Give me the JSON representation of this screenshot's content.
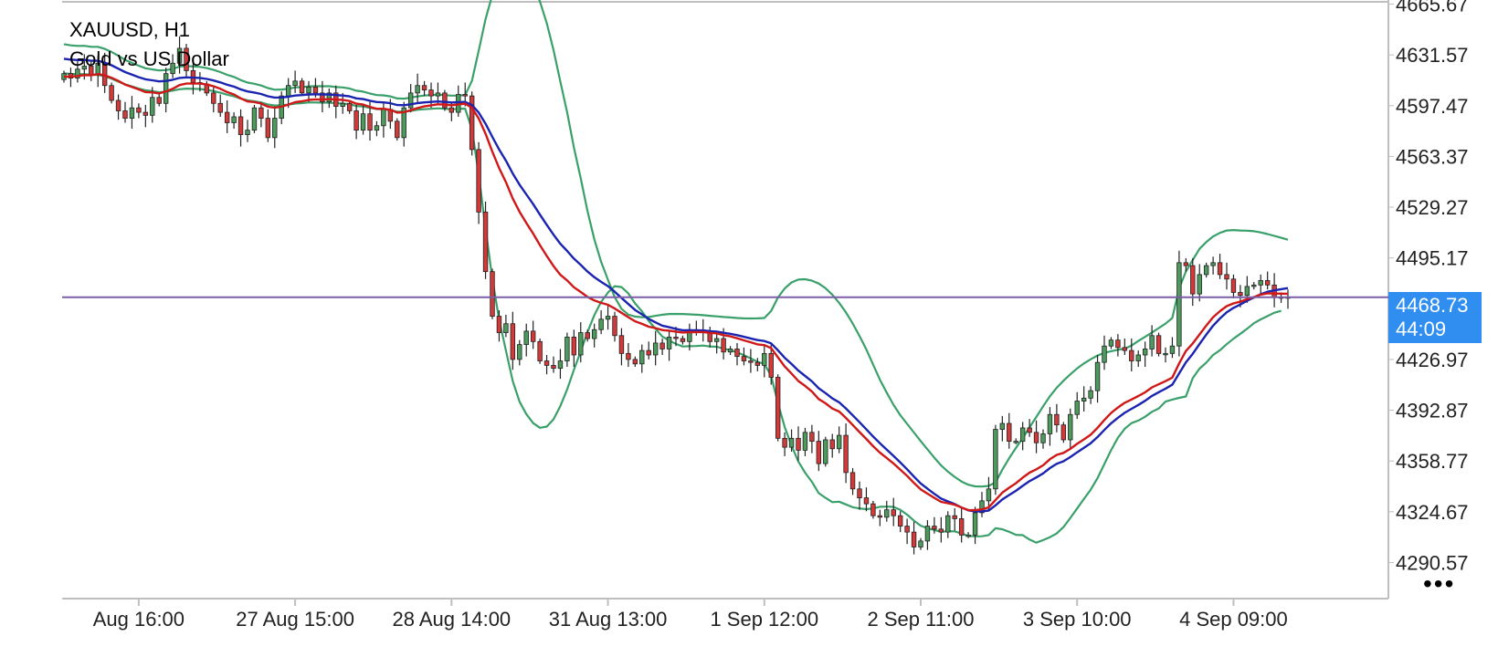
{
  "header": {
    "symbol": "XAUUSD, H1",
    "description": "Gold vs US Dollar"
  },
  "price_tag": {
    "price": "4468.73",
    "countdown": "44:09"
  },
  "menu": {
    "more_label": "•••"
  },
  "colors": {
    "bull_candle": "#4c9a5c",
    "bear_candle": "#d23a3a",
    "bollinger": "#3aa06a",
    "ma_fast": "#d01818",
    "ma_slow": "#1a24b0",
    "price_line": "#7a5ea8",
    "price_tag_bg": "#2f8ef0",
    "axis": "#bfbfbf"
  },
  "chart_data": {
    "type": "candlestick",
    "symbol": "XAUUSD",
    "timeframe": "H1",
    "current_price": 4468.73,
    "ylim": [
      4270,
      4666
    ],
    "y_ticks": [
      "4665.67",
      "4631.57",
      "4597.47",
      "4563.37",
      "4529.27",
      "4495.17",
      "4426.97",
      "4392.87",
      "4358.77",
      "4324.67",
      "4290.57"
    ],
    "y_tick_values": [
      4665.67,
      4631.57,
      4597.47,
      4563.37,
      4529.27,
      4495.17,
      4426.97,
      4392.87,
      4358.77,
      4324.67,
      4290.57
    ],
    "x_ticks": [
      {
        "label": "Aug 16:00",
        "bar": 11
      },
      {
        "label": "27 Aug 15:00",
        "bar": 34
      },
      {
        "label": "28 Aug 14:00",
        "bar": 57
      },
      {
        "label": "31 Aug 13:00",
        "bar": 80
      },
      {
        "label": "1 Sep 12:00",
        "bar": 103
      },
      {
        "label": "2 Sep 11:00",
        "bar": 126
      },
      {
        "label": "3 Sep 10:00",
        "bar": 149
      },
      {
        "label": "4 Sep 09:00",
        "bar": 172
      }
    ],
    "closes": [
      4619,
      4616,
      4622,
      4624,
      4618,
      4626,
      4611,
      4601,
      4594,
      4589,
      4596,
      4593,
      4591,
      4603,
      4599,
      4619,
      4626,
      4636,
      4621,
      4613,
      4612,
      4606,
      4599,
      4593,
      4586,
      4590,
      4578,
      4581,
      4596,
      4589,
      4576,
      4589,
      4604,
      4611,
      4614,
      4606,
      4610,
      4606,
      4600,
      4606,
      4597,
      4599,
      4594,
      4581,
      4592,
      4581,
      4584,
      4595,
      4587,
      4576,
      4596,
      4606,
      4611,
      4608,
      4604,
      4606,
      4596,
      4593,
      4605,
      4604,
      4568,
      4526,
      4486,
      4456,
      4445,
      4451,
      4427,
      4437,
      4446,
      4439,
      4426,
      4423,
      4421,
      4426,
      4442,
      4430,
      4445,
      4441,
      4447,
      4454,
      4456,
      4443,
      4431,
      4427,
      4424,
      4433,
      4430,
      4438,
      4434,
      4442,
      4441,
      4439,
      4447,
      4446,
      4446,
      4439,
      4441,
      4432,
      4434,
      4429,
      4426,
      4425,
      4423,
      4431,
      4415,
      4374,
      4368,
      4374,
      4366,
      4378,
      4372,
      4357,
      4373,
      4367,
      4376,
      4351,
      4340,
      4334,
      4330,
      4322,
      4321,
      4326,
      4322,
      4315,
      4311,
      4301,
      4305,
      4315,
      4313,
      4311,
      4322,
      4320,
      4309,
      4309,
      4324,
      4332,
      4340,
      4380,
      4384,
      4372,
      4372,
      4381,
      4378,
      4371,
      4377,
      4390,
      4383,
      4373,
      4390,
      4399,
      4401,
      4406,
      4425,
      4436,
      4440,
      4435,
      4433,
      4426,
      4430,
      4434,
      4443,
      4431,
      4431,
      4436,
      4492,
      4490,
      4471,
      4484,
      4490,
      4492,
      4484,
      4481,
      4472,
      4470,
      4476,
      4477,
      4480,
      4477,
      4469,
      4469,
      4469
    ],
    "series": [
      {
        "name": "Fast MA",
        "color": "#d01818",
        "values": [
          4617.0,
          4616.9,
          4617.4,
          4618.0,
          4617.9,
          4618.7,
          4617.9,
          4616.2,
          4614.1,
          4611.6,
          4610.1,
          4608.4,
          4606.6,
          4606.4,
          4605.7,
          4607.0,
          4608.8,
          4611.3,
          4612.3,
          4612.3,
          4612.3,
          4611.7,
          4610.5,
          4608.8,
          4606.6,
          4605.0,
          4602.4,
          4600.3,
          4599.9,
          4598.9,
          4596.8,
          4596.1,
          4596.8,
          4598.2,
          4599.8,
          4600.4,
          4601.3,
          4601.7,
          4601.5,
          4601.9,
          4601.5,
          4601.3,
          4600.6,
          4598.8,
          4598.2,
          4596.6,
          4595.4,
          4595.4,
          4594.7,
          4592.8,
          4593.1,
          4594.4,
          4595.9,
          4597.0,
          4597.7,
          4598.4,
          4598.2,
          4597.7,
          4598.3,
          4598.8,
          4596.0,
          4588.8,
          4578.6,
          4566.6,
          4555.6,
          4546.1,
          4535.2,
          4526.2,
          4518.7,
          4511.5,
          4503.8,
          4496.5,
          4489.7,
          4483.9,
          4480.1,
          4475.5,
          4472.3,
          4469.0,
          4466.6,
          4465.0,
          4463.7,
          4461.2,
          4458.3,
          4455.4,
          4452.6,
          4450.9,
          4449.0,
          4448.0,
          4446.7,
          4446.3,
          4445.7,
          4445.1,
          4445.3,
          4445.4,
          4445.4,
          4444.8,
          4444.5,
          4443.3,
          4442.5,
          4441.2,
          4439.8,
          4438.5,
          4437.1,
          4436.6,
          4434.6,
          4428.4,
          4422.3,
          4417.5,
          4412.5,
          4409.2,
          4405.4,
          4400.4,
          4397.5,
          4394.0,
          4392.0,
          4387.7,
          4382.9,
          4378.2,
          4373.6,
          4368.7,
          4364.4,
          4360.8,
          4357.1,
          4352.9,
          4348.8,
          4344.0,
          4339.7,
          4336.8,
          4334.0,
          4331.3,
          4330.4,
          4329.4,
          4327.5,
          4325.8,
          4325.7,
          4326.3,
          4327.6,
          4332.6,
          4337.5,
          4340.8,
          4343.8,
          4347.6,
          4350.9,
          4353.2,
          4355.9,
          4359.9,
          4362.9,
          4364.2,
          4366.9,
          4370.3,
          4373.3,
          4376.4,
          4381.1,
          4386.3,
          4391.0,
          4394.7,
          4397.9,
          4400.1,
          4402.4,
          4404.9,
          4408.2,
          4410.3,
          4412.4,
          4414.8,
          4424.3,
          4432.6,
          4437.7,
          4443.7,
          4449.8,
          4455.4,
          4459.4,
          4462.8,
          4464.6,
          4465.8,
          4467.5,
          4468.9,
          4470.5,
          4471.4,
          4471.3,
          4471.2,
          4471.1
        ]
      },
      {
        "name": "Slow MA",
        "color": "#1a24b0",
        "values": [
          4629.0,
          4628.4,
          4628.1,
          4628.2,
          4627.6,
          4627.6,
          4626.4,
          4624.6,
          4622.3,
          4620.0,
          4618.3,
          4616.6,
          4615.2,
          4614.5,
          4613.8,
          4614.1,
          4614.9,
          4616.1,
          4616.5,
          4616.3,
          4616.1,
          4615.4,
          4614.4,
          4613.1,
          4611.5,
          4610.3,
          4608.4,
          4607.0,
          4606.3,
          4605.3,
          4603.8,
          4602.9,
          4603.0,
          4603.5,
          4604.3,
          4604.6,
          4605.0,
          4605.1,
          4605.0,
          4605.0,
          4604.6,
          4604.3,
          4603.7,
          4602.4,
          4601.9,
          4600.8,
          4599.9,
          4599.7,
          4599.1,
          4597.9,
          4597.8,
          4598.4,
          4599.2,
          4599.7,
          4600.0,
          4600.3,
          4600.0,
          4599.6,
          4599.8,
          4600.0,
          4597.9,
          4592.8,
          4585.3,
          4576.5,
          4568.1,
          4560.5,
          4551.9,
          4544.4,
          4537.9,
          4531.3,
          4524.3,
          4517.4,
          4510.8,
          4504.7,
          4499.9,
          4494.7,
          4490.5,
          4486.0,
          4482.2,
          4479.1,
          4476.2,
          4472.5,
          4468.3,
          4464.2,
          4460.2,
          4457.3,
          4454.2,
          4451.9,
          4449.7,
          4448.6,
          4447.5,
          4446.6,
          4446.6,
          4446.5,
          4446.5,
          4446.0,
          4445.7,
          4444.9,
          4444.2,
          4443.3,
          4442.2,
          4441.1,
          4440.0,
          4439.4,
          4437.8,
          4433.1,
          4428.1,
          4423.9,
          4419.5,
          4415.9,
          4412.3,
          4407.6,
          4404.4,
          4400.8,
          4398.2,
          4394.1,
          4389.4,
          4384.8,
          4380.1,
          4375.2,
          4370.7,
          4366.4,
          4362.2,
          4357.7,
          4353.2,
          4348.3,
          4343.7,
          4340.1,
          4336.7,
          4333.5,
          4331.6,
          4329.8,
          4327.5,
          4325.6,
          4324.9,
          4324.9,
          4325.5,
          4329.0,
          4332.9,
          4335.9,
          4338.7,
          4342.1,
          4345.2,
          4347.7,
          4350.4,
          4354.0,
          4356.9,
          4358.6,
          4361.4,
          4364.6,
          4367.6,
          4370.7,
          4374.9,
          4379.6,
          4384.1,
          4387.8,
          4391.1,
          4393.8,
          4396.4,
          4399.2,
          4402.5,
          4405.0,
          4407.4,
          4410.0,
          4417.6,
          4425.0,
          4430.8,
          4437.3,
          4443.7,
          4449.7,
          4454.5,
          4458.7,
          4461.6,
          4463.9,
          4466.4,
          4468.6,
          4470.8,
          4472.5,
          4473.4,
          4474.2,
          4474.9
        ]
      },
      {
        "name": "Bollinger Upper",
        "color": "#3aa06a",
        "values": [
          4638.8,
          4638.0,
          4637.6,
          4637.7,
          4637.0,
          4637.0,
          4635.6,
          4633.6,
          4631.0,
          4628.2,
          4626.2,
          4624.3,
          4622.6,
          4621.8,
          4621.1,
          4621.4,
          4622.2,
          4623.7,
          4624.1,
          4623.8,
          4623.5,
          4622.7,
          4621.5,
          4620.0,
          4618.2,
          4616.8,
          4614.6,
          4613.0,
          4612.2,
          4611.0,
          4609.3,
          4608.2,
          4608.3,
          4608.8,
          4609.7,
          4610.0,
          4610.4,
          4610.6,
          4610.5,
          4610.5,
          4610.0,
          4609.7,
          4609.0,
          4607.5,
          4606.9,
          4605.6,
          4604.6,
          4604.4,
          4603.7,
          4602.3,
          4602.2,
          4602.8,
          4603.7,
          4604.3,
          4604.6,
          4604.9,
          4604.6,
          4604.2,
          4604.3,
          4604.5,
          4614.2,
          4634.4,
          4655.7,
          4671.9,
          4682.3,
          4688.1,
          4691.2,
          4690.2,
          4685.5,
          4678.4,
          4667.5,
          4652.9,
          4634.8,
          4613.8,
          4593.0,
          4569.4,
          4548.6,
          4526.6,
          4507.6,
          4492.6,
          4480.5,
          4468.8,
          4461.0,
          4457.1,
          4455.8,
          4455.3,
          4455.5,
          4456.3,
          4457.0,
          4457.5,
          4457.6,
          4457.5,
          4457.3,
          4457.0,
          4456.7,
          4456.3,
          4455.9,
          4455.5,
          4455.2,
          4454.8,
          4454.6,
          4454.5,
          4454.6,
          4454.8,
          4459.5,
          4468.6,
          4474.7,
          4478.7,
          4480.6,
          4480.9,
          4479.9,
          4478.0,
          4474.8,
          4470.5,
          4465.0,
          4458.6,
          4451.1,
          4442.7,
          4433.8,
          4423.5,
          4413.4,
          4404.7,
          4396.5,
          4389.5,
          4383.7,
          4377.9,
          4372.1,
          4366.6,
          4361.0,
          4355.8,
          4351.6,
          4348.1,
          4345.0,
          4342.8,
          4341.7,
          4341.6,
          4342.0,
          4344.4,
          4352.9,
          4360.6,
          4367.5,
          4374.2,
          4381.3,
          4388.4,
          4395.5,
          4402.2,
          4408.0,
          4412.7,
          4417.0,
          4420.9,
          4424.3,
          4427.1,
          4429.6,
          4431.4,
          4432.5,
          4433.5,
          4434.2,
          4436.3,
          4439.4,
          4442.2,
          4445.1,
          4448.1,
          4451.0,
          4454.8,
          4474.6,
          4486.1,
          4493.8,
          4501.3,
          4505.9,
          4509.6,
          4512.0,
          4513.6,
          4513.9,
          4513.6,
          4513.5,
          4513.1,
          4512.3,
          4511.2,
          4510.0,
          4508.7,
          4507.4
        ]
      },
      {
        "name": "Bollinger Lower",
        "color": "#3aa06a",
        "values": [
          4619.2,
          4618.8,
          4618.6,
          4618.7,
          4618.2,
          4618.2,
          4617.2,
          4615.6,
          4613.6,
          4611.8,
          4610.4,
          4608.9,
          4607.8,
          4607.2,
          4606.5,
          4606.8,
          4607.6,
          4608.5,
          4608.9,
          4608.8,
          4608.7,
          4608.1,
          4607.3,
          4606.2,
          4604.8,
          4603.8,
          4602.2,
          4601.0,
          4600.4,
          4599.6,
          4598.3,
          4597.6,
          4597.7,
          4598.2,
          4598.9,
          4599.2,
          4599.6,
          4599.6,
          4599.5,
          4599.5,
          4599.2,
          4598.9,
          4598.4,
          4597.3,
          4596.9,
          4596.0,
          4595.2,
          4595.0,
          4594.5,
          4593.5,
          4593.4,
          4594.0,
          4594.7,
          4595.1,
          4595.4,
          4595.7,
          4595.4,
          4595.0,
          4595.3,
          4595.5,
          4581.6,
          4551.2,
          4514.9,
          4481.1,
          4453.9,
          4432.9,
          4412.6,
          4398.6,
          4390.3,
          4384.2,
          4381.1,
          4381.9,
          4386.8,
          4395.6,
          4406.8,
          4420.0,
          4432.4,
          4445.4,
          4456.8,
          4465.6,
          4471.9,
          4476.2,
          4475.6,
          4471.3,
          4464.6,
          4459.3,
          4452.9,
          4447.5,
          4442.4,
          4439.7,
          4437.4,
          4435.7,
          4435.9,
          4436.0,
          4436.3,
          4435.7,
          4435.5,
          4434.3,
          4433.2,
          4431.8,
          4429.8,
          4427.7,
          4425.4,
          4424.0,
          4416.1,
          4397.6,
          4381.5,
          4369.1,
          4358.4,
          4350.9,
          4344.7,
          4337.2,
          4334.0,
          4331.1,
          4331.4,
          4329.6,
          4327.7,
          4326.9,
          4326.4,
          4326.9,
          4328.0,
          4328.1,
          4327.9,
          4325.9,
          4322.7,
          4318.7,
          4315.3,
          4313.6,
          4312.4,
          4311.2,
          4311.6,
          4311.5,
          4310.0,
          4308.4,
          4308.1,
          4308.2,
          4309.0,
          4313.6,
          4312.9,
          4311.2,
          4309.2,
          4308.9,
          4306.0,
          4303.9,
          4305.6,
          4307.6,
          4310.1,
          4314.4,
          4320.5,
          4326.8,
          4333.3,
          4339.5,
          4347.3,
          4356.7,
          4366.0,
          4374.4,
          4380.4,
          4384.2,
          4385.9,
          4388.5,
          4391.8,
          4394.1,
          4398.7,
          4400.0,
          4401.2,
          4402.1,
          4414.4,
          4420.8,
          4424.9,
          4430.0,
          4433.2,
          4437.2,
          4440.9,
          4444.2,
          4447.6,
          4451.3,
          4453.9,
          4456.1,
          4458.4,
          4459.6
        ]
      }
    ]
  }
}
